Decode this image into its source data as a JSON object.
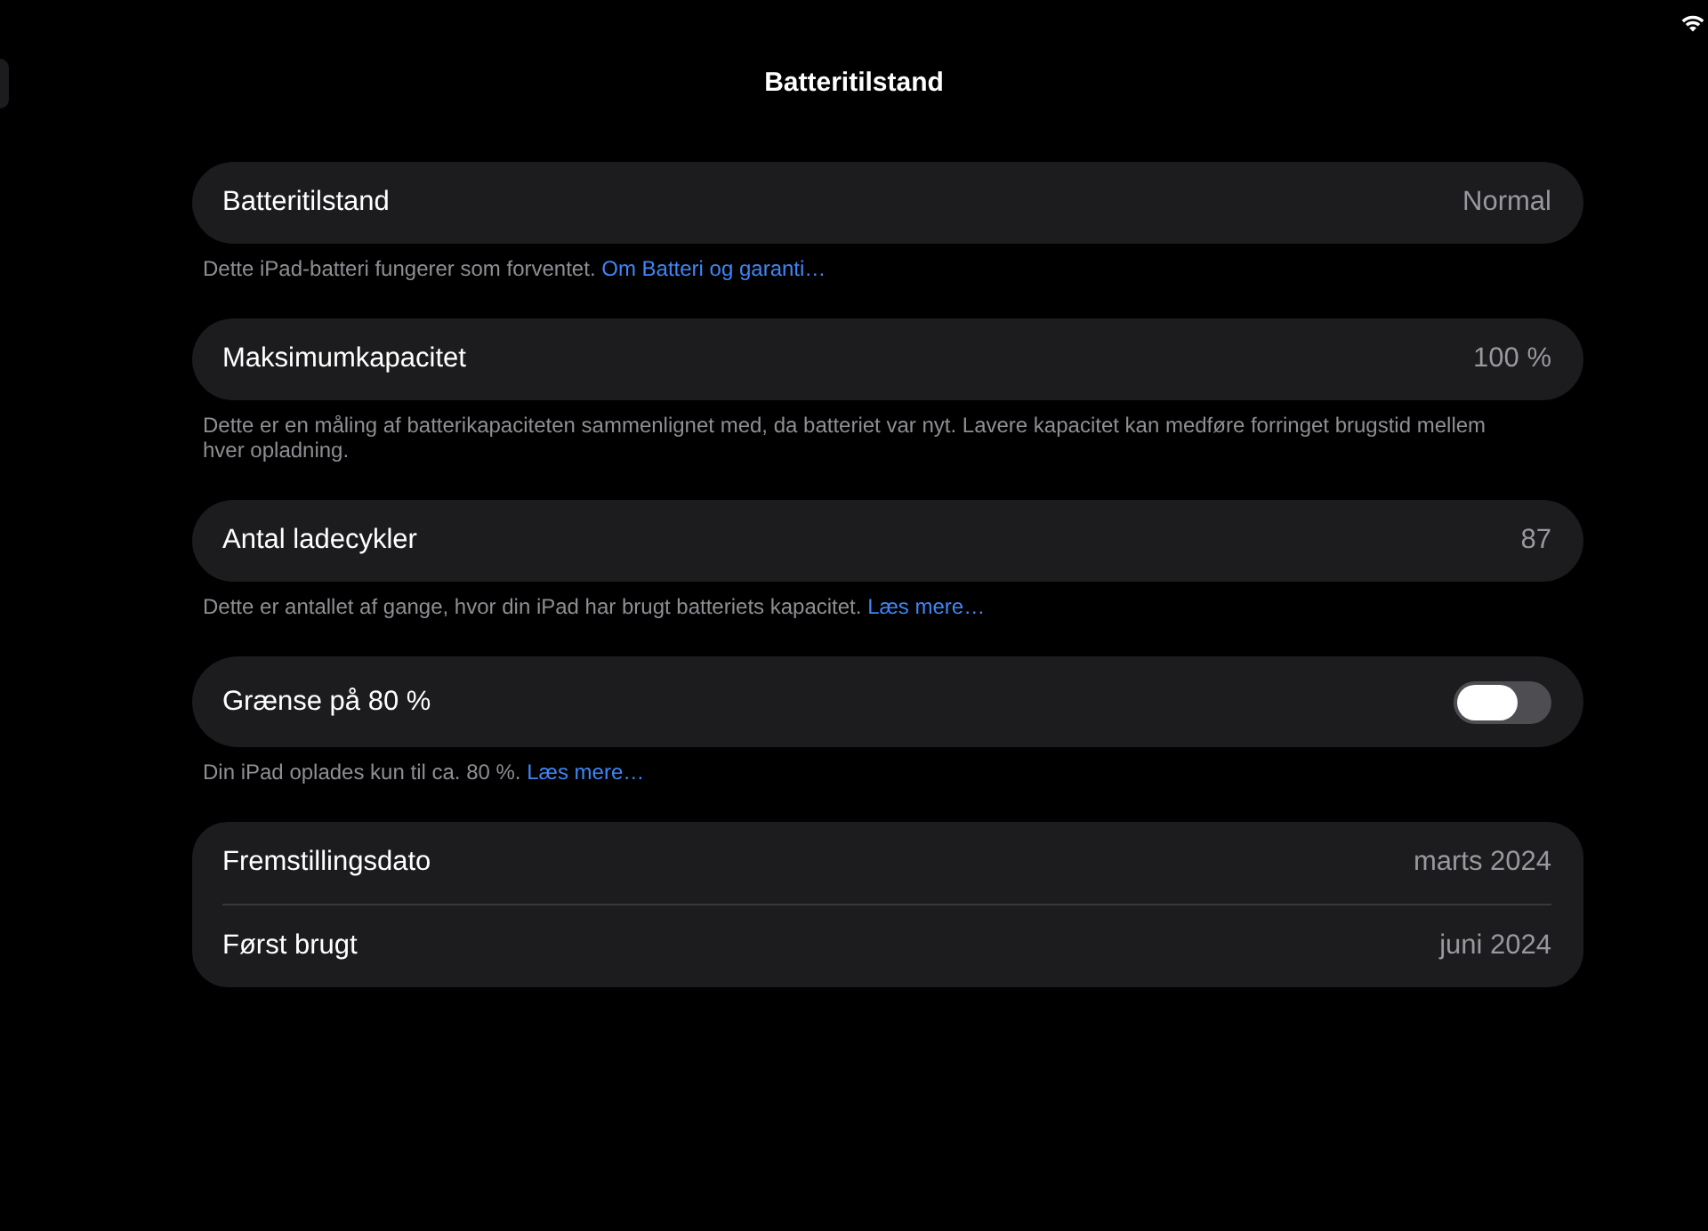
{
  "header": {
    "title": "Batteritilstand"
  },
  "sections": [
    {
      "rows": [
        {
          "kind": "value",
          "label": "Batteritilstand",
          "value": "Normal"
        }
      ],
      "footer": {
        "text": "Dette iPad-batteri fungerer som forventet.",
        "link": "Om Batteri og garanti…"
      }
    },
    {
      "rows": [
        {
          "kind": "value",
          "label": "Maksimumkapacitet",
          "value": "100 %"
        }
      ],
      "footer": {
        "text": "Dette er en måling af batterikapaciteten sammenlignet med, da batteriet var nyt. Lavere kapacitet kan medføre forringet brugstid mellem hver opladning."
      }
    },
    {
      "rows": [
        {
          "kind": "value",
          "label": "Antal ladecykler",
          "value": "87"
        }
      ],
      "footer": {
        "text": "Dette er antallet af gange, hvor din iPad har brugt batteriets kapacitet.",
        "link": "Læs mere…"
      }
    },
    {
      "rows": [
        {
          "kind": "toggle",
          "label": "Grænse på 80 %",
          "on": false
        }
      ],
      "footer": {
        "text": "Din iPad oplades kun til ca. 80 %.",
        "link": "Læs mere…"
      }
    },
    {
      "rows": [
        {
          "kind": "value",
          "label": "Fremstillingsdato",
          "value": "marts 2024"
        },
        {
          "kind": "value",
          "label": "Først brugt",
          "value": "juni 2024"
        }
      ]
    }
  ]
}
